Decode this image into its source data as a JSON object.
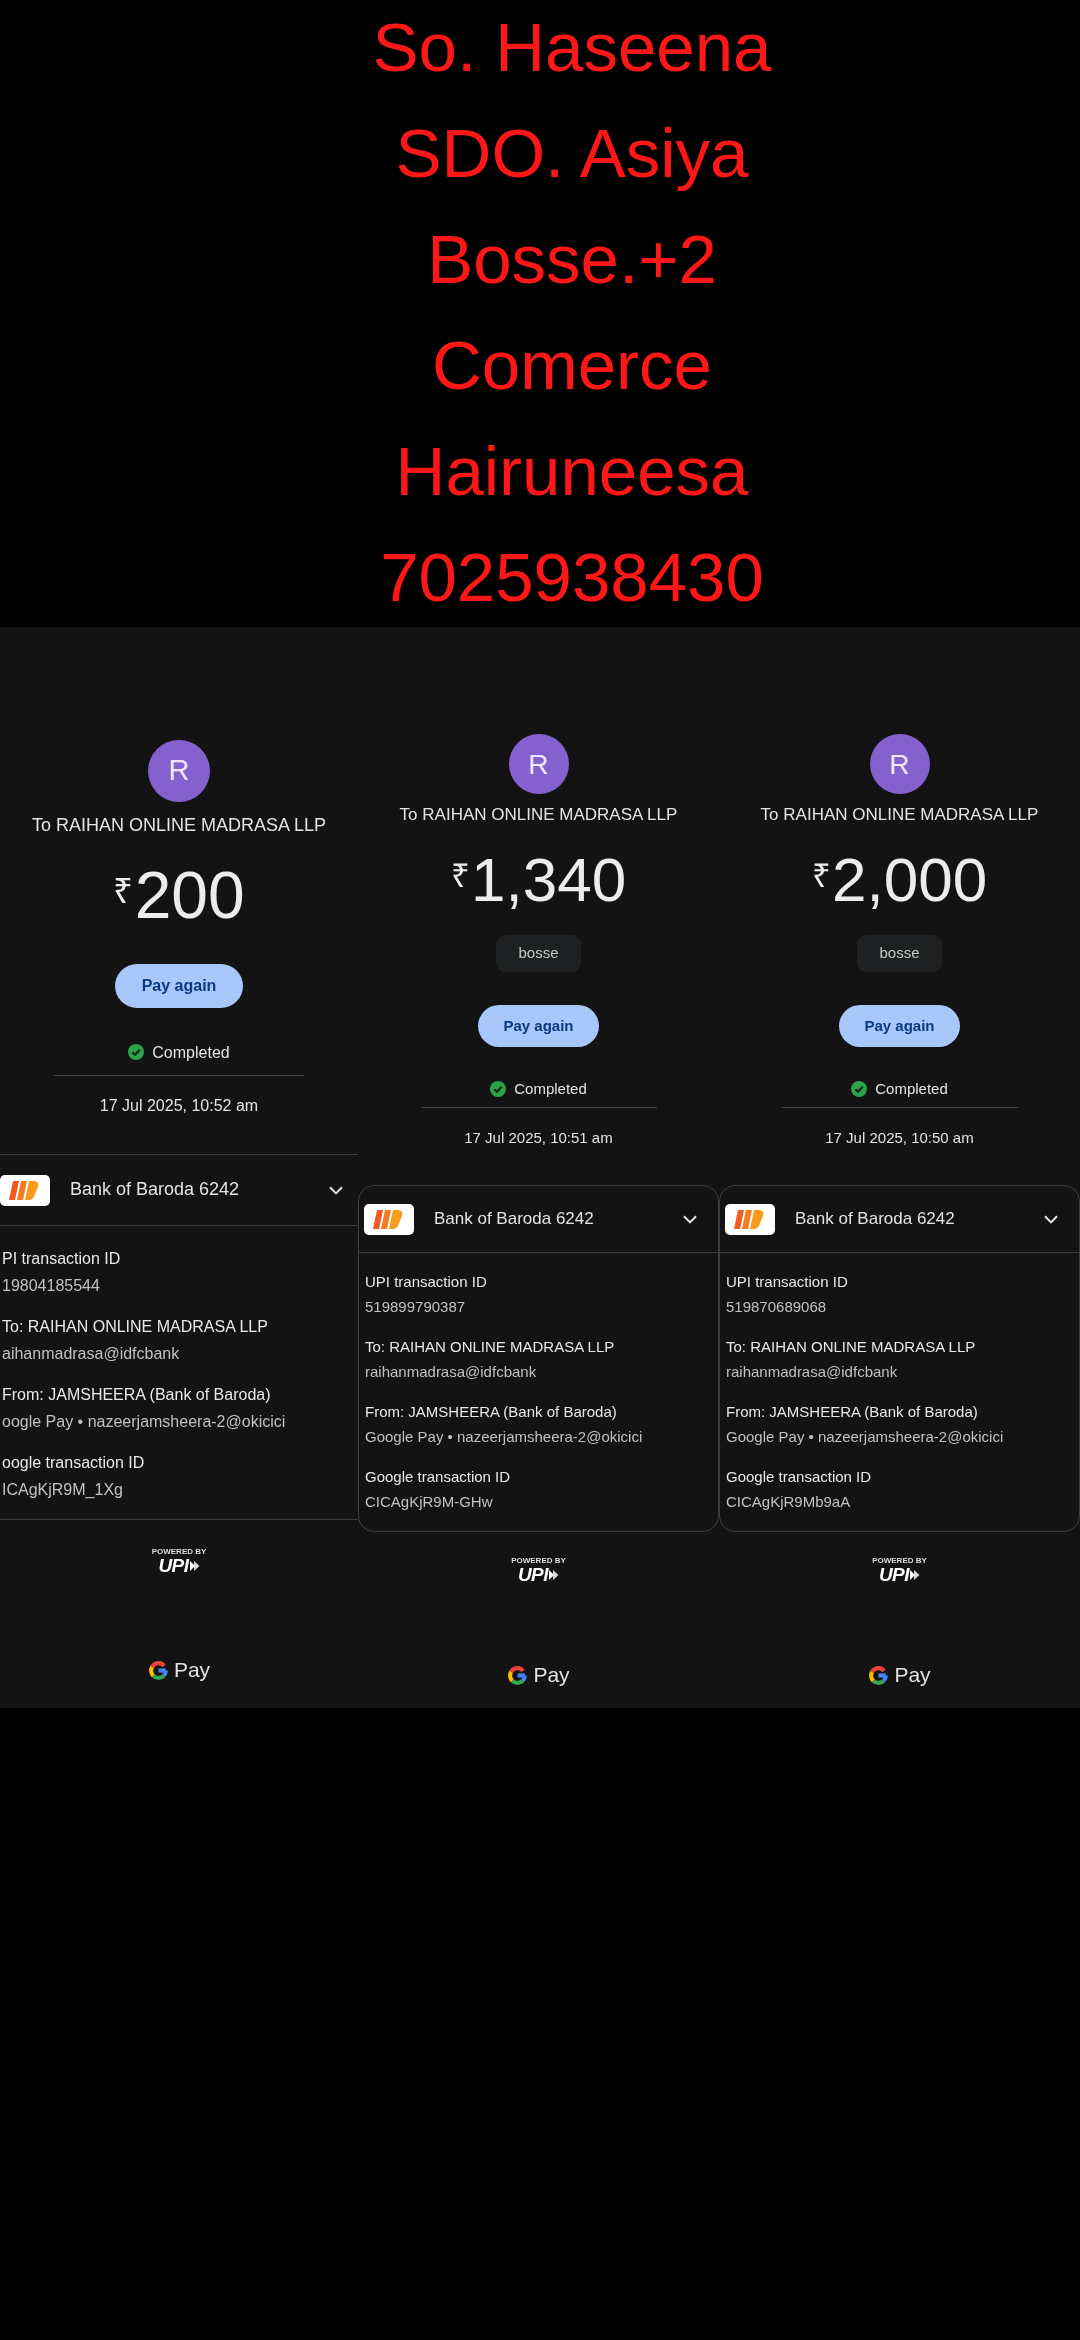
{
  "annotation_lines": [
    "So. Haseena",
    "SDO. Asiya",
    "Bosse.+2",
    "Comerce",
    "Hairuneesa",
    "7025938430"
  ],
  "receipts": [
    {
      "avatar_initial": "R",
      "payee": "To RAIHAN ONLINE MADRASA LLP",
      "amount": "$^{₹}$200",
      "pay_again_button": "Pay again",
      "status": {
        "kind": "completed",
        "label": "Completed"
      },
      "date": "17 Jul 2025, 10:52 am",
      "account": {
        "bank_name": "Bank of Baroda 6242",
        "expanded": true
      },
      "details": [
        {
          "label": "PI transaction ID",
          "value": "19804185544"
        },
        {
          "label": "To: RAIHAN ONLINE MADRASA LLP",
          "value": "aihanmadrasa@idfcbank"
        },
        {
          "label": "From: JAMSHEERA (Bank of Baroda)",
          "value": "oogle Pay • nazeerjamsheera-2@okicici"
        },
        {
          "label": "oogle transaction ID",
          "value": "ICAgKjR9M_1Xg"
        }
      ],
      "upi_badge": {
        "caption": "POWERED BY",
        "wordmark": "UPI"
      },
      "footer_brand": "Pay"
    },
    {
      "avatar_initial": "R",
      "payee": "To RAIHAN ONLINE MADRASA LLP",
      "amount": "$^{₹}$1,340",
      "note": "bosse",
      "pay_again_button": "Pay again",
      "status": {
        "kind": "completed",
        "label": "Completed"
      },
      "date": "17 Jul 2025, 10:51 am",
      "account": {
        "bank_name": "Bank of Baroda 6242",
        "expanded": true
      },
      "details": [
        {
          "label": "UPI transaction ID",
          "value": "519899790387"
        },
        {
          "label": "To: RAIHAN ONLINE MADRASA LLP",
          "value": "raihanmadrasa@idfcbank"
        },
        {
          "label": "From: JAMSHEERA (Bank of Baroda)",
          "value": "Google Pay • nazeerjamsheera-2@okicici"
        },
        {
          "label": "Google transaction ID",
          "value": "CICAgKjR9M-GHw"
        }
      ],
      "upi_badge": {
        "caption": "POWERED BY",
        "wordmark": "UPI"
      },
      "footer_brand": "Pay"
    },
    {
      "avatar_initial": "R",
      "payee": "To RAIHAN ONLINE MADRASA LLP",
      "amount": "$^{₹}$2,000",
      "note": "bosse",
      "pay_again_button": "Pay again",
      "status": {
        "kind": "completed",
        "label": "Completed"
      },
      "date": "17 Jul 2025, 10:50 am",
      "account": {
        "bank_name": "Bank of Baroda 6242",
        "expanded": true
      },
      "details": [
        {
          "label": "UPI transaction ID",
          "value": "519870689068"
        },
        {
          "label": "To: RAIHAN ONLINE MADRASA LLP",
          "value": "raihanmadrasa@idfcbank"
        },
        {
          "label": "From: JAMSHEERA (Bank of Baroda)",
          "value": "Google Pay • nazeerjamsheera-2@okicici"
        },
        {
          "label": "Google transaction ID",
          "value": "CICAgKjR9Mb9aA"
        }
      ],
      "upi_badge": {
        "caption": "POWERED BY",
        "wordmark": "UPI"
      },
      "footer_brand": "Pay"
    }
  ]
}
